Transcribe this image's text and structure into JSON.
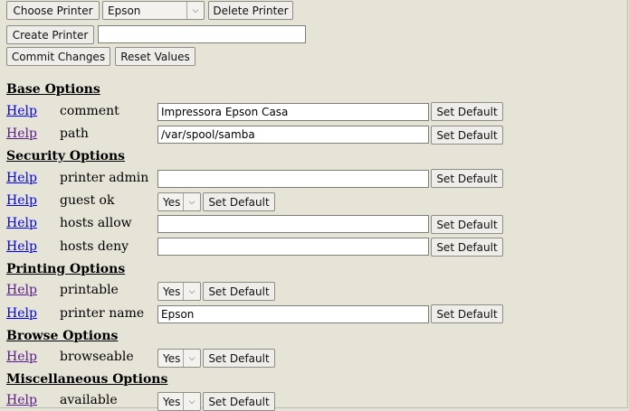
{
  "toolbar": {
    "choose_printer": "Choose Printer",
    "printer_selected": "Epson",
    "delete_printer": "Delete Printer",
    "create_printer": "Create Printer",
    "create_printer_value": "",
    "commit_changes": "Commit Changes",
    "reset_values": "Reset Values"
  },
  "help_label": "Help",
  "set_default_label": "Set Default",
  "sections": {
    "base": "Base Options",
    "security": "Security Options",
    "printing": "Printing Options",
    "browse": "Browse Options",
    "misc": "Miscellaneous Options"
  },
  "params": {
    "comment": {
      "name": "comment",
      "value": "Impressora Epson Casa"
    },
    "path": {
      "name": "path",
      "value": "/var/spool/samba"
    },
    "printer_admin": {
      "name": "printer admin",
      "value": ""
    },
    "guest_ok": {
      "name": "guest ok",
      "value": "Yes"
    },
    "hosts_allow": {
      "name": "hosts allow",
      "value": ""
    },
    "hosts_deny": {
      "name": "hosts deny",
      "value": ""
    },
    "printable": {
      "name": "printable",
      "value": "Yes"
    },
    "printer_name": {
      "name": "printer name",
      "value": "Epson"
    },
    "browseable": {
      "name": "browseable",
      "value": "Yes"
    },
    "available": {
      "name": "available",
      "value": "Yes"
    }
  },
  "colors": {
    "background": "#e6e4d6",
    "link": "#0000ee",
    "visited_link": "#551a8b"
  }
}
